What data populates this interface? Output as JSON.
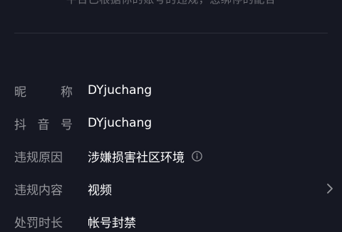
{
  "notice": {
    "text": "平台已根据你的账号的违规，您绑停的配合"
  },
  "rows": [
    {
      "label_chars": [
        "昵",
        "称"
      ],
      "value": "DYjuchang"
    },
    {
      "label_chars": [
        "抖",
        "音",
        "号"
      ],
      "value": "DYjuchang"
    },
    {
      "label": "违规原因",
      "value": "涉嫌损害社区环境",
      "icon": "info-icon"
    },
    {
      "label": "违规内容",
      "value": "视频",
      "icon": "chevron-right-icon"
    },
    {
      "label": "处罚时长",
      "value": "帐号封禁"
    }
  ],
  "colors": {
    "background": "#161823",
    "label": "rgba(255,255,255,0.55)",
    "value": "#ffffff"
  }
}
